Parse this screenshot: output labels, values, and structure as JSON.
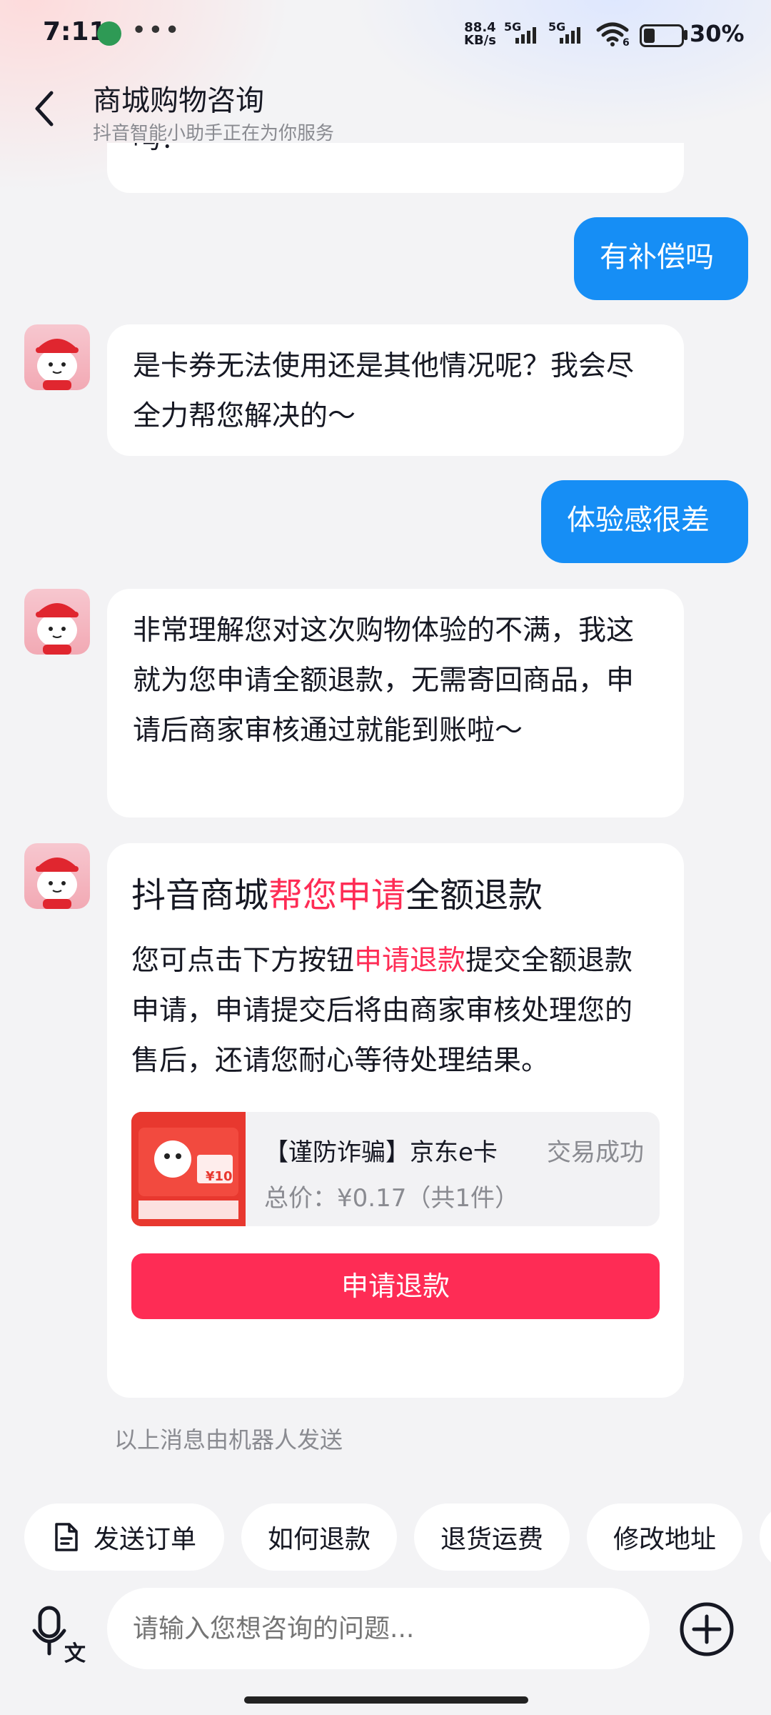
{
  "status_bar": {
    "time": "7:11",
    "dots": "•••",
    "net_speed_value": "88.4",
    "net_speed_unit": "KB/s",
    "sim1_type": "5G",
    "sim2_type": "5G",
    "wifi_badge": "6",
    "battery_percent": 30,
    "battery_text": "30%"
  },
  "header": {
    "title": "商城购物咨询",
    "subtitle": "抖音智能小助手正在为你服务"
  },
  "messages": {
    "partial_top_text": "吗？",
    "user_msg_1": "有补偿吗",
    "bot_msg_1": "是卡券无法使用还是其他情况呢？我会尽全力帮您解决的～",
    "user_msg_2": "体验感很差",
    "bot_msg_2": "非常理解您对这次购物体验的不满，我这就为您申请全额退款，无需寄回商品，申请后商家审核通过就能到账啦～",
    "card": {
      "title_part1": "抖音商城",
      "title_highlight": "帮您申请",
      "title_part2": "全额退款",
      "body_part1": "您可点击下方按钮",
      "body_highlight": "申请退款",
      "body_part2": "提交全额退款申请，申请提交后将由商家审核处理您的售后，还请您耐心等待处理结果。",
      "order_name": "【谨防诈骗】京东e卡",
      "order_status": "交易成功",
      "order_price": "总价：¥0.17（共1件）",
      "thumb_value": "¥10",
      "refund_button": "申请退款"
    },
    "bot_note": "以上消息由机器人发送"
  },
  "quick_replies": [
    "发送订单",
    "如何退款",
    "退货运费",
    "修改地址"
  ],
  "input": {
    "placeholder": "请输入您想咨询的问题..."
  },
  "colors": {
    "user_bubble": "#168ef5",
    "accent_pink": "#fe2c55",
    "background": "#f3f3f5"
  },
  "icons": {
    "back": "chevron-left-icon",
    "order": "document-icon",
    "voice": "voice-translate-icon",
    "plus": "plus-circle-icon"
  }
}
